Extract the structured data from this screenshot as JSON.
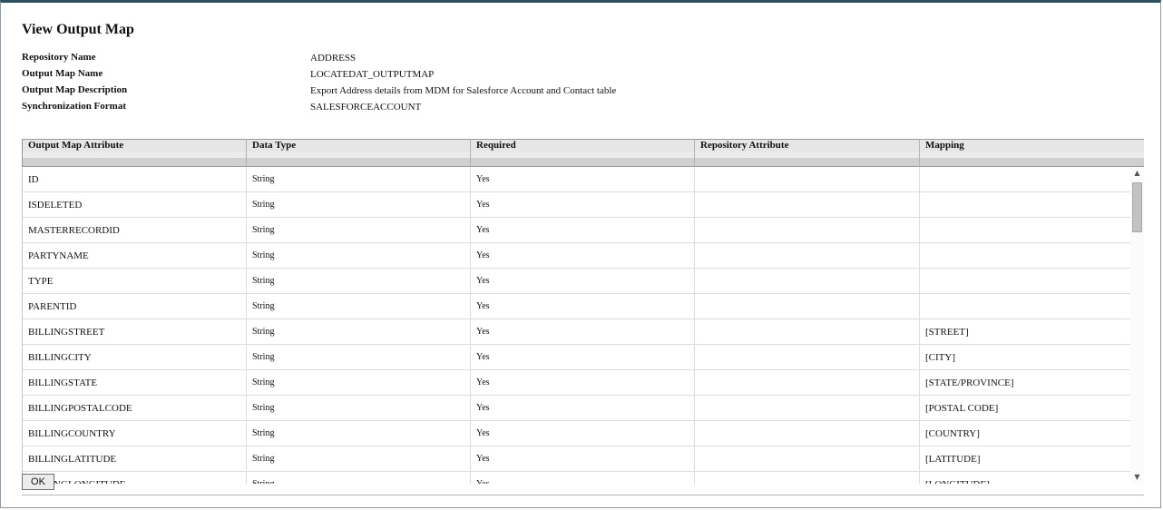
{
  "page": {
    "title": "View Output Map"
  },
  "details": [
    {
      "label": "Repository Name",
      "value": "ADDRESS"
    },
    {
      "label": "Output Map Name",
      "value": "LOCATEDAT_OUTPUTMAP"
    },
    {
      "label": "Output Map Description",
      "value": "Export Address details from MDM for Salesforce Account and Contact table"
    },
    {
      "label": "Synchronization Format",
      "value": "SALESFORCEACCOUNT"
    }
  ],
  "table": {
    "headers": [
      "Output Map Attribute",
      "Data Type",
      "Required",
      "Repository Attribute",
      "Mapping"
    ],
    "rows": [
      [
        "ID",
        "String",
        "Yes",
        "",
        ""
      ],
      [
        "ISDELETED",
        "String",
        "Yes",
        "",
        ""
      ],
      [
        "MASTERRECORDID",
        "String",
        "Yes",
        "",
        ""
      ],
      [
        "PARTYNAME",
        "String",
        "Yes",
        "",
        ""
      ],
      [
        "TYPE",
        "String",
        "Yes",
        "",
        ""
      ],
      [
        "PARENTID",
        "String",
        "Yes",
        "",
        ""
      ],
      [
        "BILLINGSTREET",
        "String",
        "Yes",
        "",
        "[STREET]"
      ],
      [
        "BILLINGCITY",
        "String",
        "Yes",
        "",
        "[CITY]"
      ],
      [
        "BILLINGSTATE",
        "String",
        "Yes",
        "",
        "[STATE/PROVINCE]"
      ],
      [
        "BILLINGPOSTALCODE",
        "String",
        "Yes",
        "",
        "[POSTAL CODE]"
      ],
      [
        "BILLINGCOUNTRY",
        "String",
        "Yes",
        "",
        "[COUNTRY]"
      ],
      [
        "BILLINGLATITUDE",
        "String",
        "Yes",
        "",
        "[LATITUDE]"
      ],
      [
        "BILLINGLONGITUDE",
        "String",
        "Yes",
        "",
        "[LONGITUDE]"
      ]
    ]
  },
  "scrollbar": {
    "up_glyph": "▲",
    "down_glyph": "▼"
  },
  "buttons": {
    "ok_label": "OK"
  }
}
